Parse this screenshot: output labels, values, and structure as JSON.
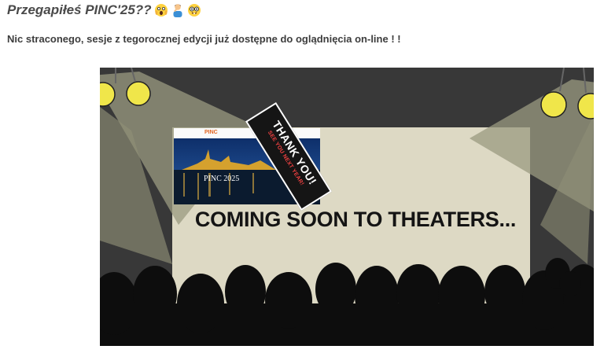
{
  "post": {
    "title": "Przegapiłeś PINC'25??",
    "emojis": [
      "face-screaming-in-fear-icon",
      "person-facepalming-icon",
      "nerd-face-icon"
    ],
    "subtitle": "Nic straconego, sesje z tegorocznej edycji już dostępne do oglądnięcia on-line ! !"
  },
  "image": {
    "screen_title": "COMING SOON TO THEATERS...",
    "website_logo": "PINC",
    "website_title": "PINC 2025",
    "banner_main": "THANK YOU!",
    "banner_sub": "SEE YOU NEXT YEAR!"
  },
  "colors": {
    "heading_text": "#4a4a4a",
    "stage_background": "#383838",
    "spotlight": "#f0e64a",
    "screen": "#ddd9c4",
    "audience": "#0d0d0d",
    "banner_accent": "#f04040"
  }
}
